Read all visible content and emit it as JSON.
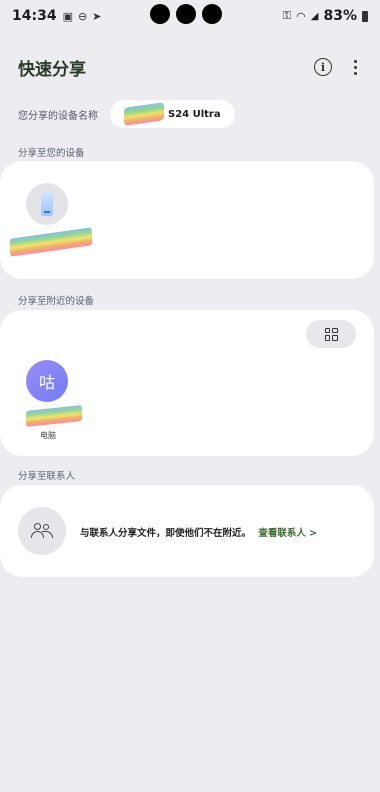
{
  "status_bar": {
    "time": "14:34",
    "battery": "83%"
  },
  "header": {
    "title": "快速分享"
  },
  "device_name": {
    "label": "您分享的设备名称",
    "value": "S24 Ultra"
  },
  "sections": {
    "your_devices": "分享至您的设备",
    "nearby_devices": "分享至附近的设备",
    "contacts": "分享至联系人"
  },
  "nearby": {
    "device_avatar_char": "咕",
    "device_label": "电脑"
  },
  "contacts_card": {
    "text": "与联系人分享文件，即使他们不在附近。",
    "link": "查看联系人 >"
  }
}
